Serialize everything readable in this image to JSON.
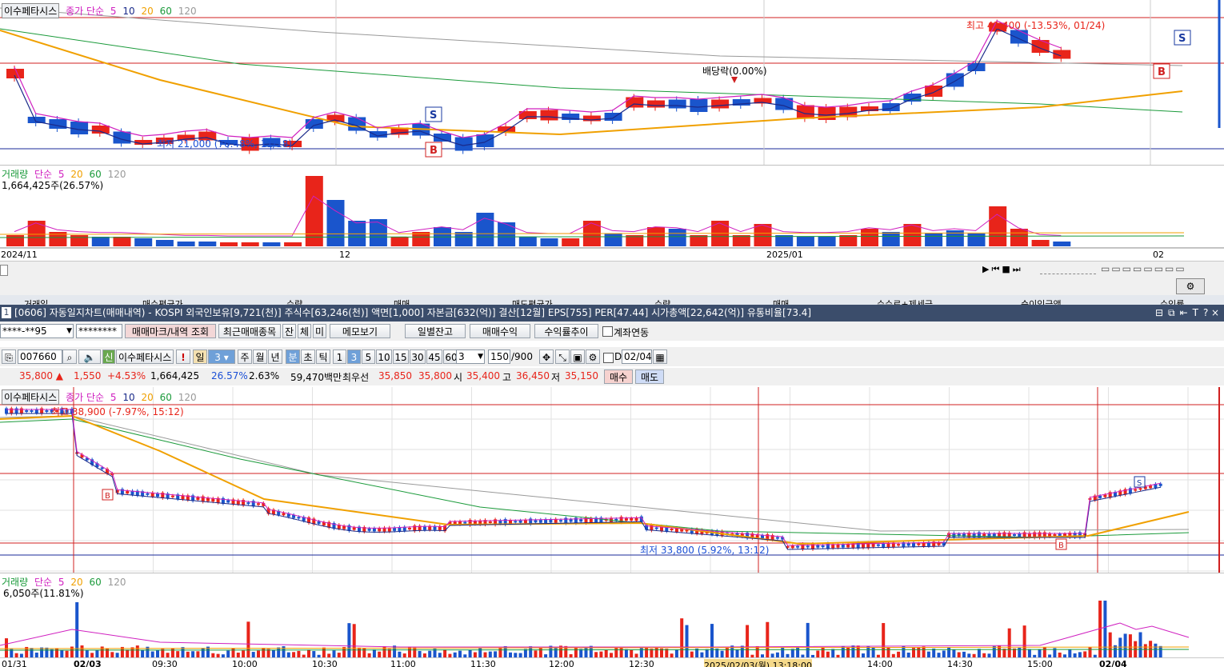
{
  "upper_chart": {
    "stock_tag": "이수페타시스",
    "legend": {
      "type": "종가 단순",
      "periods": [
        "5",
        "10",
        "20",
        "60",
        "120"
      ]
    },
    "high_label": "최고 41,400 (-13.53%, 01/24)",
    "low_label": "최저 21,000 (70.48%, 11/18)",
    "dividend_label": "배당락(0.00%)",
    "buy_marker": "B",
    "sell_marker": "S",
    "volume_legend": {
      "name": "거래량",
      "type": "단순",
      "periods": [
        "5",
        "20",
        "60",
        "120"
      ]
    },
    "volume_value": "1,664,425주(26.57%)",
    "x_axis": [
      "2024/11",
      "12",
      "2025/01",
      "02"
    ]
  },
  "middle_headers": [
    "거래일",
    "매수평균가",
    "수량",
    "매매",
    "매도평균가",
    "수량",
    "매매",
    "수수료+제세금",
    "순이익금액",
    "수익률"
  ],
  "window": {
    "number": "1",
    "title": "[0606] 자동일지차트(매매내역) - KOSPI 외국인보유[9,721(천)] 주식수[63,246(천)] 액면[1,000] 자본금[632(억)] 결산[12월] EPS[755] PER[47.44] 시가총액[22,642(억)] 유통비율[73.4]"
  },
  "toolbar1": {
    "account": "****-**95",
    "password": "********",
    "buttons": [
      "매매마크/내역 조회",
      "최근매매종목",
      "잔",
      "체",
      "미",
      "메모보기",
      "일별잔고",
      "매매수익",
      "수익률추이"
    ],
    "checkbox_label": "계좌연동"
  },
  "toolbar2": {
    "code": "007660",
    "stock_button": "이수페타시스",
    "exclaim": "!",
    "periods": [
      "일",
      "3",
      "주",
      "월",
      "년",
      "분",
      "초",
      "틱"
    ],
    "minutes": [
      "1",
      "3",
      "5",
      "10",
      "15",
      "30",
      "45",
      "60"
    ],
    "count_select": "3",
    "count": "150",
    "count_total": "/900",
    "date_prefix": "D",
    "date": "02/04"
  },
  "quote": {
    "price": "35,800 ▲",
    "change": "1,550",
    "pct": "+4.53%",
    "volume": "1,664,425",
    "vol_pct": "26.57%",
    "turnover": "2.63%",
    "amount": "59,470백만",
    "best_label": "최우선",
    "ask": "35,850",
    "bid": "35,800",
    "open_label": "시",
    "open": "35,400",
    "high_label": "고",
    "high": "36,450",
    "low_label": "저",
    "low": "35,150",
    "buy_button": "매수",
    "sell_button": "매도"
  },
  "lower_chart": {
    "stock_tag": "이수페타시스",
    "legend": {
      "type": "종가 단순",
      "periods": [
        "5",
        "10",
        "20",
        "60",
        "120"
      ]
    },
    "high_label": "최고 38,900 (-7.97%, 15:12)",
    "low_label": "최저 33,800 (5.92%, 13:12)",
    "volume_legend": {
      "name": "거래량",
      "type": "단순",
      "periods": [
        "5",
        "20",
        "60",
        "120"
      ]
    },
    "volume_value": "6,050주(11.81%)",
    "x_axis": [
      "01/31",
      "02/03",
      "09:30",
      "10:00",
      "10:30",
      "11:00",
      "11:30",
      "12:00",
      "12:30",
      "2025/02/03(월) 13:18:00",
      "14:00",
      "14:30",
      "15:00",
      "02/04"
    ]
  },
  "colors": {
    "up": "#e8241a",
    "down": "#1a55cc",
    "ma5": "#d020c0",
    "ma10": "#1a2a8a",
    "ma20": "#f0a000",
    "ma60": "#1a9a3a",
    "ma120": "#999999",
    "title_bg": "#3b4d6b"
  }
}
